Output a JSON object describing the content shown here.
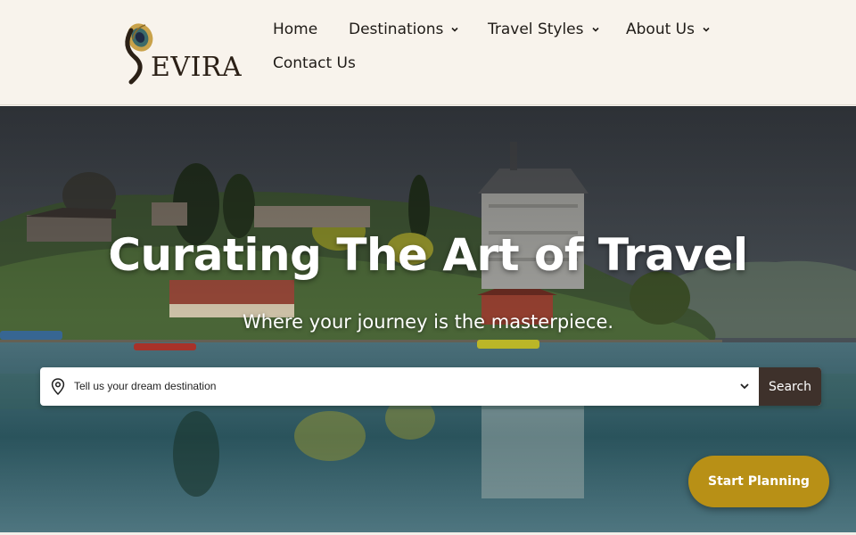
{
  "brand": {
    "name": "EVIRA",
    "logo_icon": "peacock-feather-s-logo"
  },
  "nav": {
    "items": [
      {
        "label": "Home",
        "has_dropdown": false
      },
      {
        "label": "Destinations",
        "has_dropdown": true
      },
      {
        "label": "Travel Styles",
        "has_dropdown": true
      },
      {
        "label": "About Us",
        "has_dropdown": true
      },
      {
        "label": "Contact Us",
        "has_dropdown": false
      }
    ]
  },
  "hero": {
    "title": "Curating The Art of Travel",
    "subtitle": "Where your journey is the masterpiece."
  },
  "search": {
    "placeholder": "Tell us your dream destination",
    "value": "",
    "button_label": "Search",
    "icon": "map-pin-icon",
    "dropdown_icon": "chevron-down-icon"
  },
  "cta": {
    "label": "Start Planning",
    "color": "#b89016"
  },
  "colors": {
    "header_bg": "#f8f3ec",
    "search_button_bg": "#3e312b",
    "accent_gold": "#b89016"
  }
}
